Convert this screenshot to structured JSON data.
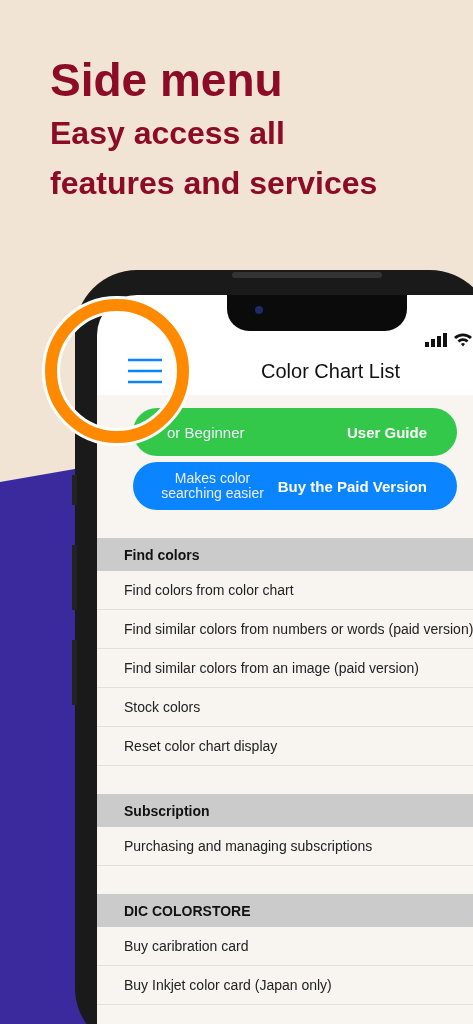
{
  "headline": {
    "title": "Side menu",
    "subtitle_lines": [
      "Easy access all",
      "features and services"
    ]
  },
  "screen": {
    "nav": {
      "title": "Color Chart List"
    },
    "buttons": [
      {
        "kind": "guide",
        "caption": "or Beginner",
        "label": "User Guide"
      },
      {
        "kind": "paid",
        "caption": "Makes color searching easier",
        "label": "Buy the Paid Version"
      }
    ],
    "sections": [
      {
        "title": "Find colors",
        "items": [
          "Find colors from color chart",
          "Find similar colors from numbers or words (paid version)",
          "Find similar colors from an image (paid version)",
          "Stock colors",
          "Reset color chart display"
        ]
      },
      {
        "title": "Subscription",
        "items": [
          "Purchasing and managing subscriptions"
        ]
      },
      {
        "title": "DIC COLORSTORE",
        "items": [
          "Buy caribration card",
          "Buy Inkjet color card (Japan only)"
        ]
      }
    ]
  }
}
